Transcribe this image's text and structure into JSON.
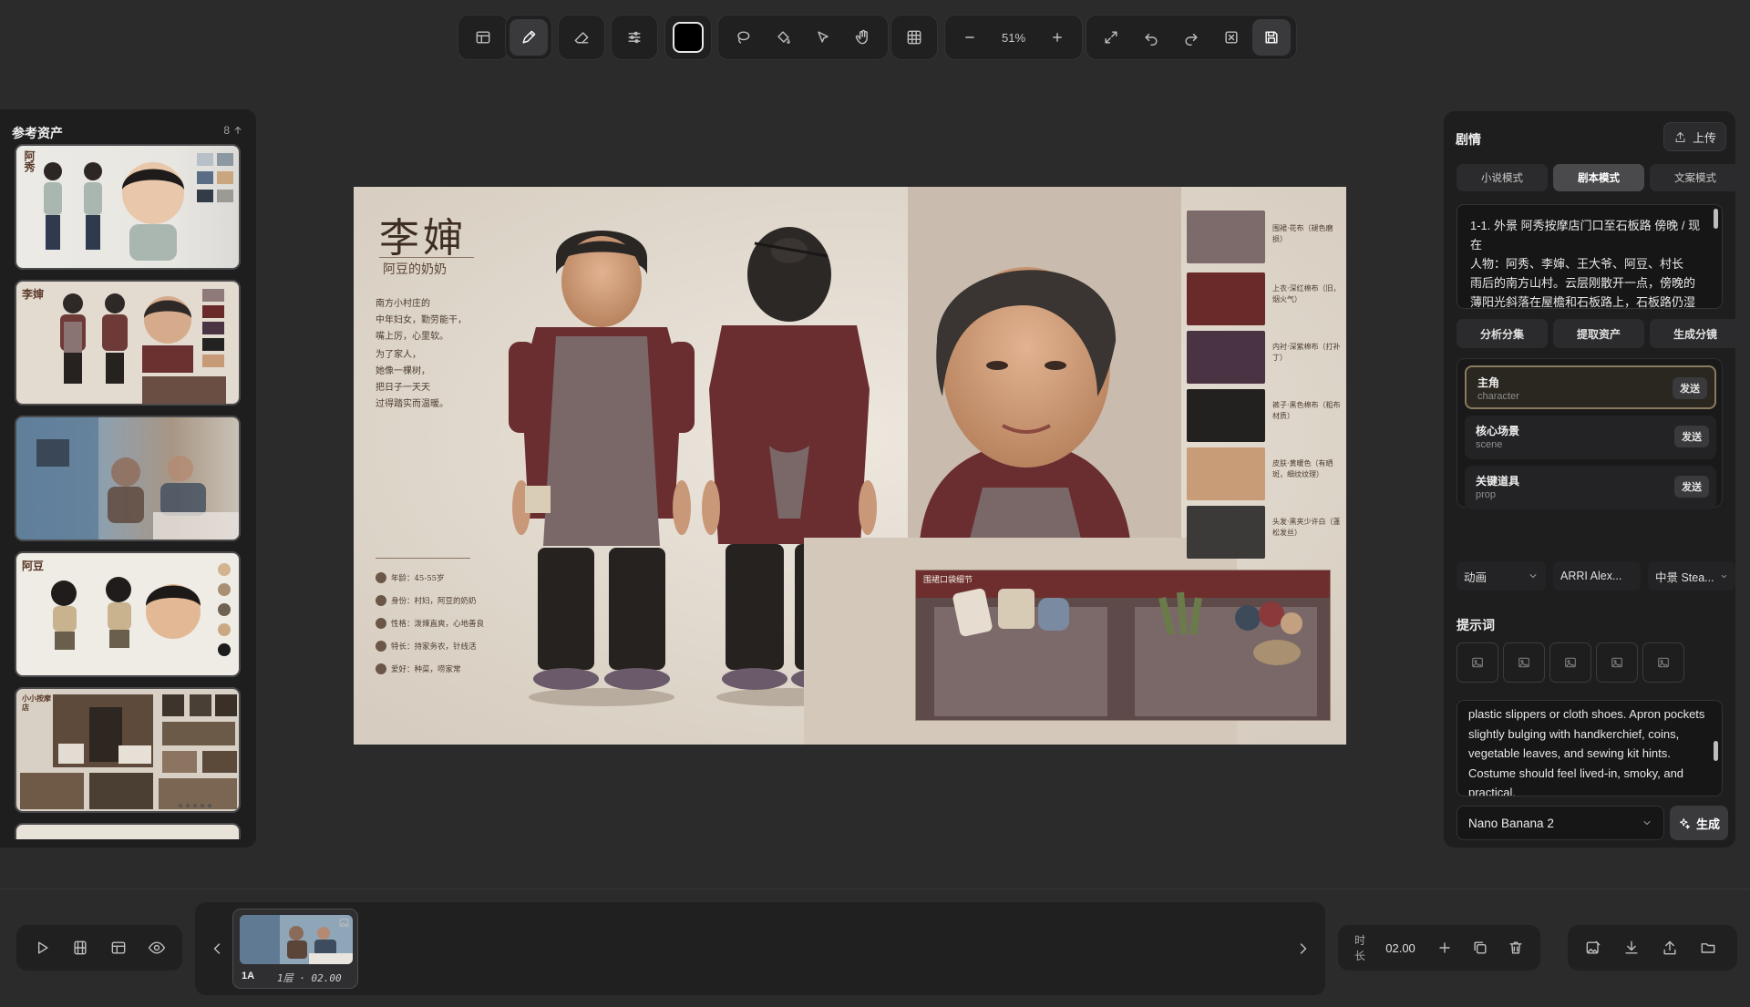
{
  "toolbar": {
    "zoom": "51%",
    "color": "#000000",
    "tools": [
      "layout-icon",
      "pen-icon",
      "eraser-icon",
      "sliders-icon",
      "lasso-icon",
      "fill-icon",
      "select-icon",
      "hand-icon",
      "grid-icon"
    ]
  },
  "assets": {
    "title": "参考资产",
    "count": "8",
    "items": [
      {
        "label": "阿秀"
      },
      {
        "label": "李婶"
      },
      {
        "label": ""
      },
      {
        "label": "阿豆"
      },
      {
        "label": "小小按摩店"
      }
    ]
  },
  "canvas": {
    "title": "李婶",
    "subtitle": "阿豆的奶奶",
    "poem1": [
      "南方小村庄的",
      "中年妇女，勤劳能干，",
      "嘴上厉，心里软。"
    ],
    "poem2": [
      "为了家人，",
      "她像一棵树，",
      "把日子一天天",
      "过得踏实而温暖。"
    ],
    "attributes": [
      "年龄：45-55岁",
      "身份：村妇，阿豆的奶奶",
      "性格：泼辣直爽，心地善良",
      "特长：持家务农，针线活",
      "爱好：种菜，唠家常"
    ],
    "swatches": [
      {
        "note": "围裙·花布（褪色磨损）",
        "color": "#7d6a6a"
      },
      {
        "note": "上衣·深红棉布（旧，烟火气）",
        "color": "#6b2a2a"
      },
      {
        "note": "内衬·深紫棉布（打补丁）",
        "color": "#4a3444"
      },
      {
        "note": "裤子·黑色棉布（粗布材质）",
        "color": "#232120"
      },
      {
        "note": "皮肤·黄暖色（有晒斑，细纹纹理）",
        "color": "#c89c76"
      },
      {
        "note": "头发·黑夹少许白（蓬松发丝）",
        "color": "#3c3a38"
      }
    ],
    "detail_label": "围裙口袋细节"
  },
  "story": {
    "title": "剧情",
    "upload_label": "上传",
    "modes": [
      "小说模式",
      "剧本模式",
      "文案模式"
    ],
    "active_mode": 1,
    "script_lines": [
      "1-1. 外景 阿秀按摩店门口至石板路 傍晚 / 现在",
      "人物：阿秀、李婶、王大爷、阿豆、村长",
      "雨后的南方山村。云层刚散开一点，傍晚的",
      "薄阳光斜落在屋檐和石板路上，石板路仍湿"
    ],
    "actions": [
      "分析分集",
      "提取资产",
      "生成分镜"
    ],
    "types": [
      {
        "name": "主角",
        "en": "character",
        "send": "发送"
      },
      {
        "name": "核心场景",
        "en": "scene",
        "send": "发送"
      },
      {
        "name": "关键道具",
        "en": "prop",
        "send": "发送"
      }
    ],
    "dropdowns": [
      "动画",
      "ARRI Alex...",
      "中景 Stea..."
    ],
    "prompt_title": "提示词",
    "prompt_text": "plastic slippers or cloth shoes. Apron pockets slightly bulging with handkerchief, coins, vegetable leaves, and sewing kit hints. Costume should feel lived-in, smoky, and practical.",
    "model": "Nano Banana 2",
    "generate_label": "生成"
  },
  "timeline": {
    "frame_id": "1A",
    "frame_meta": "1层 · 02.00",
    "duration_label": "时长",
    "duration_value": "02.00"
  }
}
